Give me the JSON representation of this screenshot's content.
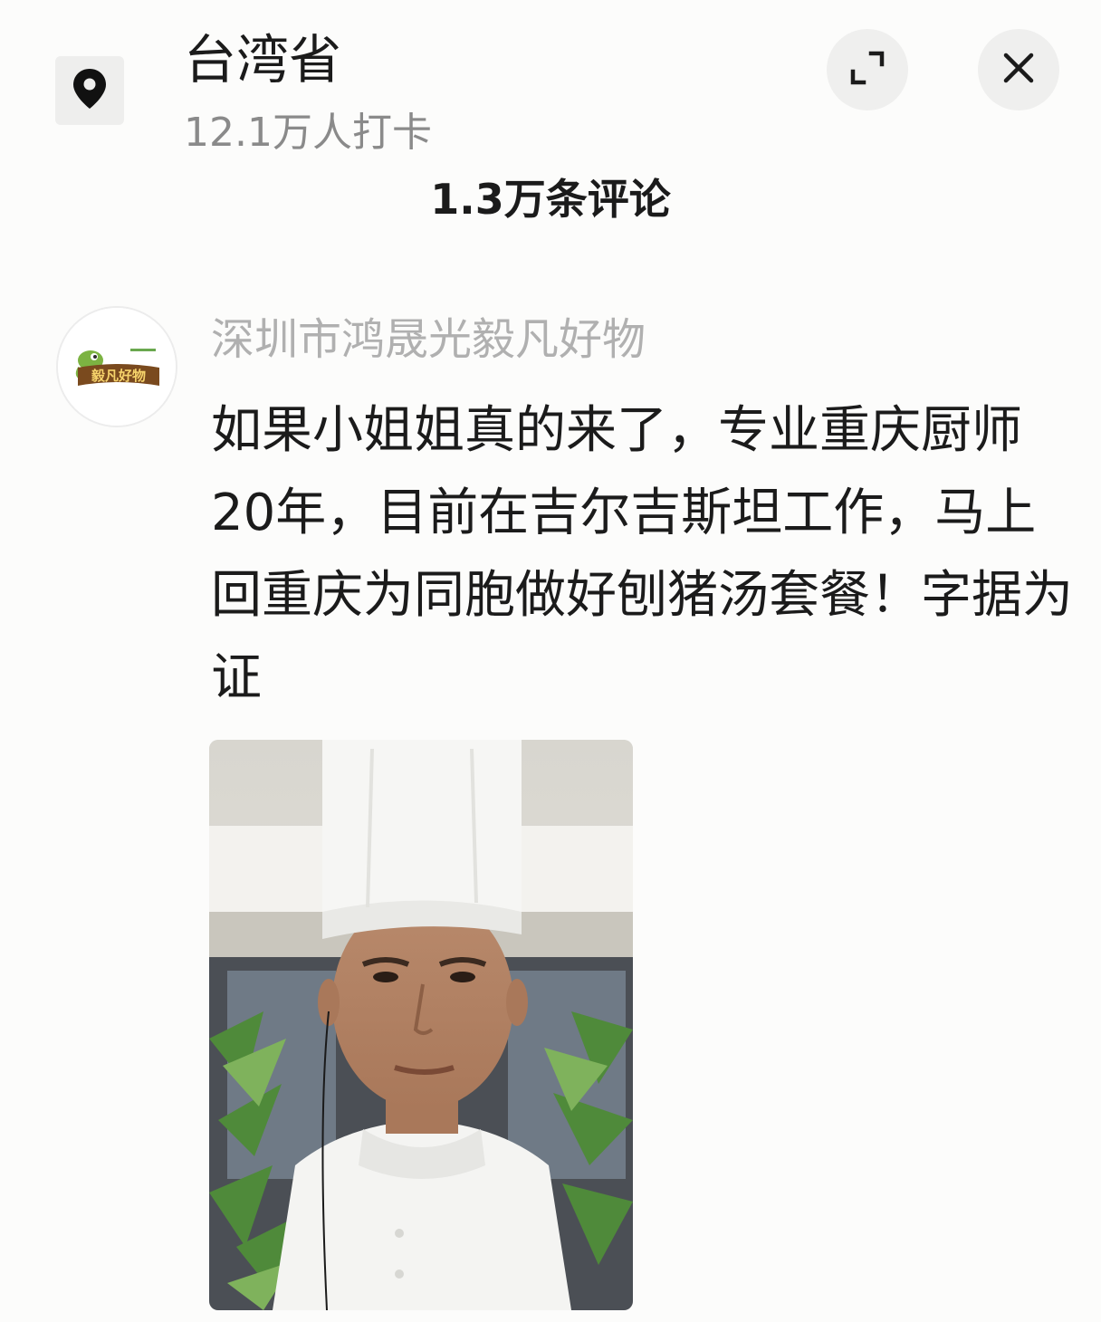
{
  "header": {
    "location_icon": "location-pin-icon",
    "title": "台湾省",
    "checkin_text": "12.1万人打卡",
    "expand_icon": "expand-icon",
    "close_icon": "close-icon",
    "comments_count": "1.3万条评论"
  },
  "comment": {
    "username": "深圳市鸿晟光毅凡好物",
    "avatar_brand": "毅凡好物",
    "text": "如果小姐姐真的来了，专业重庆厨师20年，目前在吉尔吉斯坦工作，马上回重庆为同胞做好刨猪汤套餐！字据为证",
    "photo_icon": "chef-photo"
  },
  "colors": {
    "background": "#fcfcfb",
    "primary_text": "#1b1b1b",
    "secondary_text": "#8a8a8a",
    "username_text": "#b0b0b0",
    "button_bg": "#efefee",
    "avatar_green": "#6aa84f"
  }
}
